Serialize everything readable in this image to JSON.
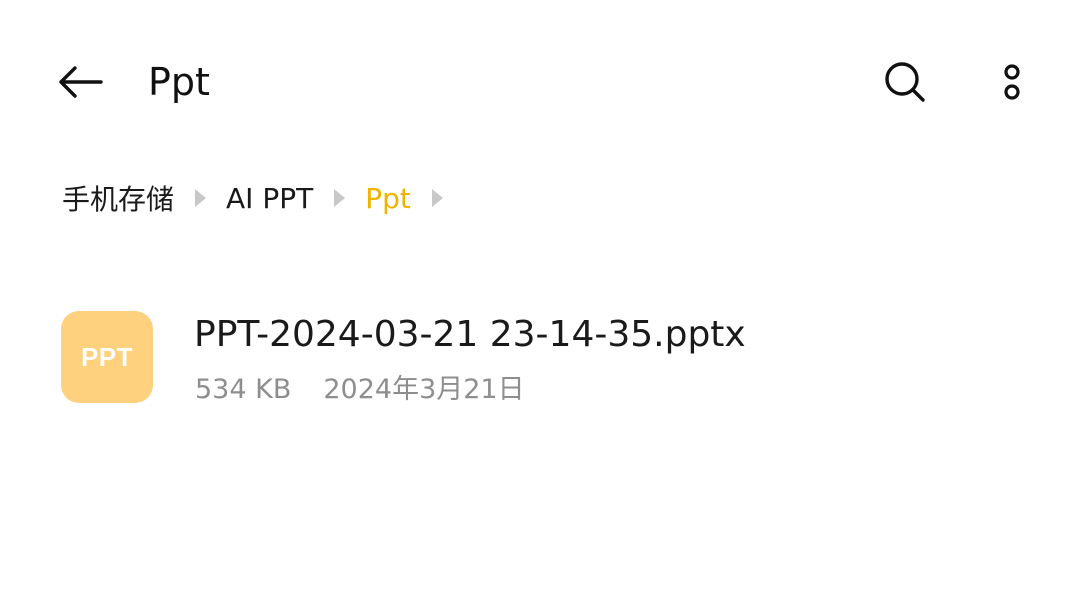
{
  "header": {
    "title": "Ppt",
    "back_icon": "arrow-left-icon",
    "search_icon": "search-icon",
    "more_icon": "more-vertical-icon"
  },
  "breadcrumb": [
    {
      "label": "手机存储",
      "active": false
    },
    {
      "label": "AI PPT",
      "active": false
    },
    {
      "label": "Ppt",
      "active": true
    }
  ],
  "files": [
    {
      "icon_label": "PPT",
      "name": "PPT-2024-03-21 23-14-35.pptx",
      "size": "534 KB",
      "date": "2024年3月21日"
    }
  ],
  "colors": {
    "accent": "#f0b400",
    "ppt_icon_bg": "#fdd17e",
    "meta_text": "#8e8e8e",
    "separator": "#c8c8c8"
  }
}
